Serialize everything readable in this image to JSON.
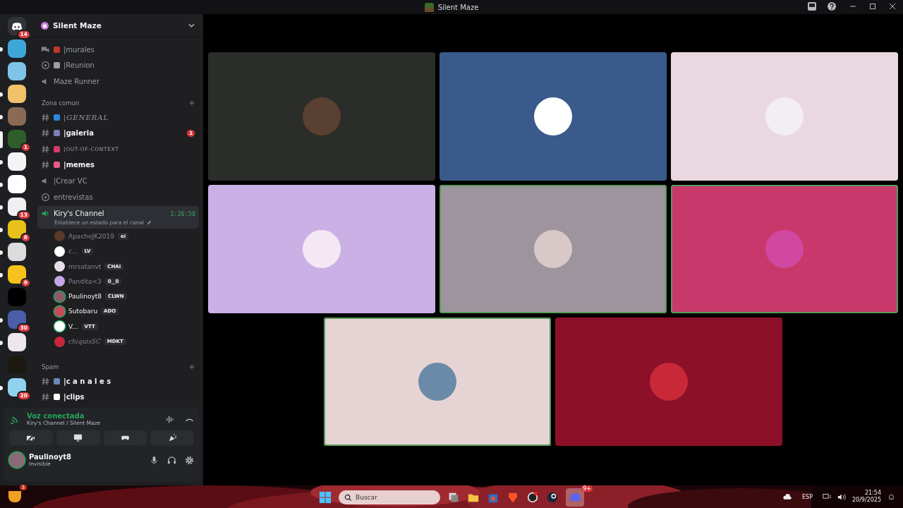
{
  "window": {
    "title": "Silent Maze"
  },
  "servers": [
    {
      "color": "#313338",
      "badge": "14",
      "unread": false,
      "kind": "home"
    },
    {
      "color": "#3fa6d8",
      "unread": true,
      "kind": "avatar"
    },
    {
      "color": "#7fc4e8",
      "unread": false,
      "kind": "avatar"
    },
    {
      "color": "#f2c26b",
      "unread": true,
      "kind": "avatar"
    },
    {
      "color": "#8a6a52",
      "unread": true,
      "kind": "avatar"
    },
    {
      "color": "#2f5e2a",
      "badge": "1",
      "unread": false,
      "selected": true,
      "kind": "avatar"
    },
    {
      "color": "#f4f4f4",
      "unread": true,
      "kind": "avatar"
    },
    {
      "color": "#ffffff",
      "unread": true,
      "kind": "avatar"
    },
    {
      "color": "#f0f0f0",
      "badge": "13",
      "unread": true,
      "kind": "avatar"
    },
    {
      "color": "#e8c21a",
      "badge": "8",
      "unread": true,
      "kind": "avatar"
    },
    {
      "color": "#dcdcdc",
      "unread": true,
      "kind": "avatar"
    },
    {
      "color": "#f7c21b",
      "badge": "9",
      "unread": true,
      "kind": "avatar"
    },
    {
      "color": "#000000",
      "unread": false,
      "kind": "avatar"
    },
    {
      "color": "#4a5fa8",
      "badge": "30",
      "unread": true,
      "kind": "avatar"
    },
    {
      "color": "#ece6ee",
      "unread": true,
      "kind": "avatar"
    },
    {
      "color": "#1c1a10",
      "unread": false,
      "kind": "avatar"
    },
    {
      "color": "#8fd3ef",
      "badge": "20",
      "unread": true,
      "kind": "avatar"
    }
  ],
  "server_name": "Silent Maze",
  "channels": [
    {
      "kind": "forum",
      "name": "|murales",
      "color": "#c0392b",
      "unread": false
    },
    {
      "kind": "stage",
      "name": "|Reunion",
      "color": "#9aa0a6",
      "unread": false
    },
    {
      "kind": "voice",
      "name": "Maze Runner",
      "unread": false
    },
    {
      "kind": "category",
      "name": "Zona comun"
    },
    {
      "kind": "text",
      "name": "|GENERAL",
      "color": "#2e86de",
      "unread": false
    },
    {
      "kind": "text",
      "name": "|galeria",
      "color": "#7a7fb8",
      "unread": true,
      "badge": "1"
    },
    {
      "kind": "text",
      "name": "|OUT-OF-CONTEXT",
      "color": "#d63a6a",
      "unread": false
    },
    {
      "kind": "text",
      "name": "|memes",
      "color": "#e85a8a",
      "unread": true
    },
    {
      "kind": "voice",
      "name": "|Crear VC",
      "unread": false
    },
    {
      "kind": "stage",
      "name": "entrevistas",
      "unread": false
    }
  ],
  "voice_channel": {
    "name": "Kiry's Channel",
    "timer": "1:26:50",
    "status": "Establece un estado para el canal",
    "members": [
      {
        "name": "ApacheJK2019",
        "tag": "ei",
        "color": "#5a3a2a",
        "speaking": false
      },
      {
        "name": "c...",
        "tag": "LV",
        "color": "#ffffff",
        "speaking": false
      },
      {
        "name": "mrsatanvt",
        "tag": "CHAI",
        "color": "#e8dde8",
        "speaking": false
      },
      {
        "name": "Pandita<3",
        "tag": "0‿0",
        "color": "#c7a6e8",
        "speaking": false
      },
      {
        "name": "Paulinoyt8",
        "tag": "CLWN",
        "color": "#8a5a6a",
        "speaking": true
      },
      {
        "name": "Sutobaru",
        "tag": "ADO",
        "color": "#c84a5a",
        "speaking": true
      },
      {
        "name": "V...",
        "tag": "VTT",
        "color": "#ffffff",
        "speaking": true
      },
      {
        "name": "chiquisSC",
        "tag": "MDKT",
        "color": "#c8283a",
        "speaking": false
      }
    ]
  },
  "spam_category": {
    "name": "Spam",
    "channels": [
      {
        "kind": "text",
        "name": "|c a n a l e s",
        "color": "#6a8ab8",
        "unread": true
      },
      {
        "kind": "text",
        "name": "|clips",
        "color": "#ffffff",
        "unread": true
      }
    ]
  },
  "voice_panel": {
    "status": "Voz conectada",
    "location": "Kiry's Channel / Silent Maze"
  },
  "user": {
    "name": "Paulinoyt8",
    "status": "Invisible"
  },
  "video_tiles": [
    {
      "color": "#2b2d2a",
      "avatar": {
        "color": "#5a4030"
      },
      "speaking": false
    },
    {
      "color": "#3a5a8c",
      "avatar": {
        "color": "#ffffff"
      },
      "speaking": false
    },
    {
      "color": "#ead8e0",
      "avatar": {
        "color": "#f2eef2"
      },
      "speaking": false
    },
    {
      "color": "#cbb0e6",
      "avatar": {
        "color": "#f4e8f4"
      },
      "speaking": false
    },
    {
      "color": "#9e949e",
      "avatar": {
        "color": "#d8c8c8"
      },
      "speaking": true
    },
    {
      "color": "#c8386a",
      "avatar": {
        "color": "#d048a0"
      },
      "speaking": true
    },
    {
      "color": "#e6d4d4",
      "avatar": {
        "color": "#6a8aa8"
      },
      "speaking": true
    },
    {
      "color": "#8c1028",
      "avatar": {
        "color": "#c82838"
      },
      "speaking": false
    }
  ],
  "taskbar": {
    "widget_badge": "3",
    "search": {
      "placeholder": "Buscar"
    },
    "app_badge": "9+",
    "language": "ESP",
    "time": "21:54",
    "date": "20/9/2025"
  }
}
